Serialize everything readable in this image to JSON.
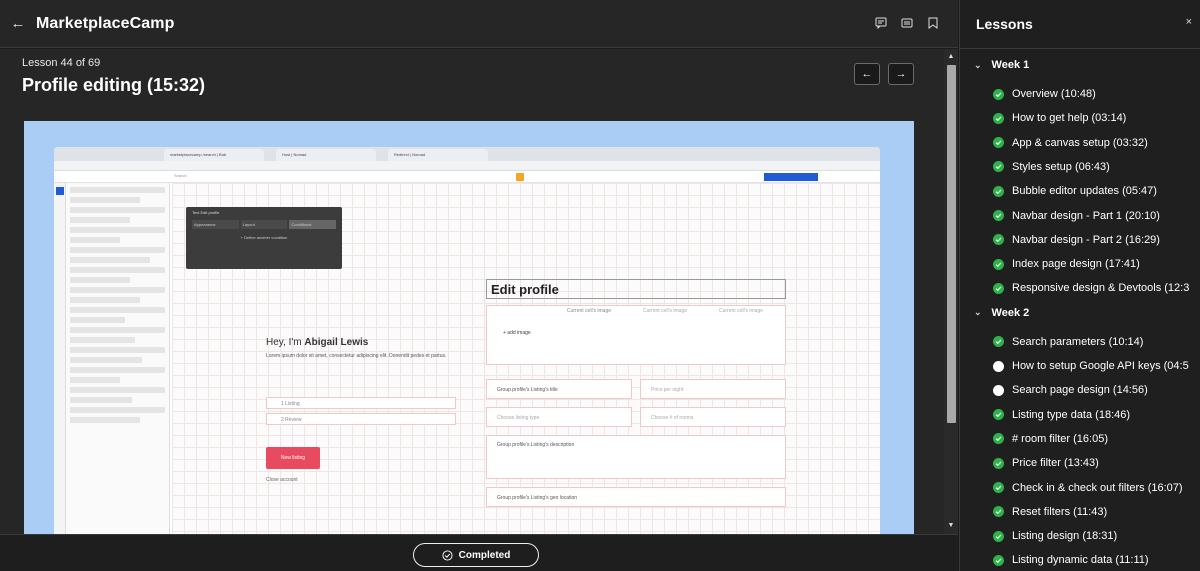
{
  "header": {
    "back_icon": "←",
    "brand": "MarketplaceCamp"
  },
  "lesson": {
    "counter": "Lesson 44 of 69",
    "title": "Profile editing (15:32)",
    "prev": "←",
    "next": "→"
  },
  "video": {
    "tabs": [
      "marketplacecamp /search | Bub",
      "Host | Nomad",
      "Redirect | Nomad"
    ],
    "edit_profile": "Edit profile",
    "greeting": "Hey, I'm ",
    "greeting_name": "Abigail Lewis",
    "panel_title": "Text Edit profile",
    "panel_tabs": [
      "Appearance",
      "Layout",
      "Conditional"
    ],
    "panel_define": "+ Define another condition",
    "search": "Search",
    "group_fields": [
      "Group profile's Listing's title",
      "Group profile's Listing's description",
      "Group profile's Listing's geo location"
    ],
    "price": "Price per night",
    "choose_type": "Choose listing type",
    "choose_rooms": "Choose # of rooms",
    "add_image": "+ add image",
    "listing": "1 Listing",
    "review": "2 Review",
    "new_listing": "New listing",
    "close_account": "Close account",
    "cells": [
      "Current cell's image",
      "Current cell's image",
      "Current cell's image"
    ],
    "lorem": "Lorem ipsum dolor sit amet, consectetur adipiscing elit. Donendit pedes et partus."
  },
  "footer": {
    "completed": "Completed"
  },
  "sidebar": {
    "title": "Lessons",
    "close": "×",
    "weeks": [
      {
        "label": "Week 1",
        "items": [
          {
            "label": "Overview (10:48)",
            "status": "done"
          },
          {
            "label": "How to get help (03:14)",
            "status": "done"
          },
          {
            "label": "App & canvas setup (03:32)",
            "status": "done"
          },
          {
            "label": "Styles setup (06:43)",
            "status": "done"
          },
          {
            "label": "Bubble editor updates (05:47)",
            "status": "done"
          },
          {
            "label": "Navbar design - Part 1 (20:10)",
            "status": "done"
          },
          {
            "label": "Navbar design - Part 2 (16:29)",
            "status": "done"
          },
          {
            "label": "Index page design (17:41)",
            "status": "done"
          },
          {
            "label": "Responsive design & Devtools (12:3",
            "status": "done"
          }
        ]
      },
      {
        "label": "Week 2",
        "items": [
          {
            "label": "Search parameters (10:14)",
            "status": "done"
          },
          {
            "label": "How to setup Google API keys (04:5",
            "status": "todo"
          },
          {
            "label": "Search page design (14:56)",
            "status": "todo"
          },
          {
            "label": "Listing type data (18:46)",
            "status": "done"
          },
          {
            "label": "# room filter (16:05)",
            "status": "done"
          },
          {
            "label": "Price filter (13:43)",
            "status": "done"
          },
          {
            "label": "Check in & check out filters (16:07)",
            "status": "done"
          },
          {
            "label": "Reset filters (11:43)",
            "status": "done"
          },
          {
            "label": "Listing design (18:31)",
            "status": "done"
          },
          {
            "label": "Listing dynamic data (11:11)",
            "status": "done"
          }
        ]
      }
    ]
  },
  "colors": {
    "done": "#2db34a",
    "todo": "#ffffff",
    "bg": "#262626"
  }
}
